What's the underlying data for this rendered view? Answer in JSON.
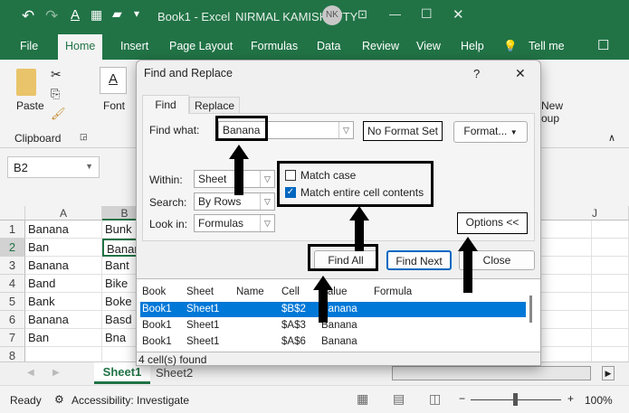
{
  "titlebar": {
    "doc_title": "Book1  -  Excel",
    "user": "NIRMAL KAMISHETTY",
    "avatar": "NK"
  },
  "ribbon_tabs": [
    "File",
    "Home",
    "Insert",
    "Page Layout",
    "Formulas",
    "Data",
    "Review",
    "View",
    "Help",
    "Tell me"
  ],
  "ribbon": {
    "paste": "Paste",
    "font": "Font",
    "clipboard": "Clipboard",
    "new_group_1": "New",
    "new_group_2": "oup"
  },
  "namebox": "B2",
  "columns": [
    "A",
    "B",
    "J"
  ],
  "rows": [
    {
      "n": "1",
      "a": "Banana",
      "b": "Bunk"
    },
    {
      "n": "2",
      "a": "Ban",
      "b": "Banar"
    },
    {
      "n": "3",
      "a": "Banana",
      "b": "Bant"
    },
    {
      "n": "4",
      "a": "Band",
      "b": "Bike"
    },
    {
      "n": "5",
      "a": "Bank",
      "b": "Boke"
    },
    {
      "n": "6",
      "a": "Banana",
      "b": "Basd"
    },
    {
      "n": "7",
      "a": "Ban",
      "b": "Bna"
    },
    {
      "n": "8",
      "a": "",
      "b": ""
    }
  ],
  "sheets": [
    "Sheet1",
    "Sheet2"
  ],
  "status": {
    "ready": "Ready",
    "accessibility": "Accessibility: Investigate",
    "zoom": "100%"
  },
  "dialog": {
    "title": "Find and Replace",
    "help": "?",
    "close": "✕",
    "tabs": [
      "Find",
      "Replace"
    ],
    "find_what_label": "Find what:",
    "find_what_value": "Banana",
    "no_format": "No Format Set",
    "format": "Format...",
    "within_label": "Within:",
    "within": "Sheet",
    "search_label": "Search:",
    "search": "By Rows",
    "lookin_label": "Look in:",
    "lookin": "Formulas",
    "match_case": "Match case",
    "match_case_checked": false,
    "match_entire": "Match entire cell contents",
    "match_entire_checked": true,
    "options": "Options <<",
    "find_all": "Find All",
    "find_next": "Find Next",
    "close_btn": "Close",
    "results_headers": [
      "Book",
      "Sheet",
      "Name",
      "Cell",
      "Value",
      "Formula"
    ],
    "results": [
      {
        "book": "Book1",
        "sheet": "Sheet1",
        "name": "",
        "cell": "$B$2",
        "value": "Banana",
        "formula": "",
        "selected": true
      },
      {
        "book": "Book1",
        "sheet": "Sheet1",
        "name": "",
        "cell": "$A$3",
        "value": "Banana",
        "formula": ""
      },
      {
        "book": "Book1",
        "sheet": "Sheet1",
        "name": "",
        "cell": "$A$6",
        "value": "Banana",
        "formula": ""
      }
    ],
    "found": "4 cell(s) found"
  },
  "colors": {
    "excel_green": "#217346",
    "selection": "#0078d7"
  }
}
